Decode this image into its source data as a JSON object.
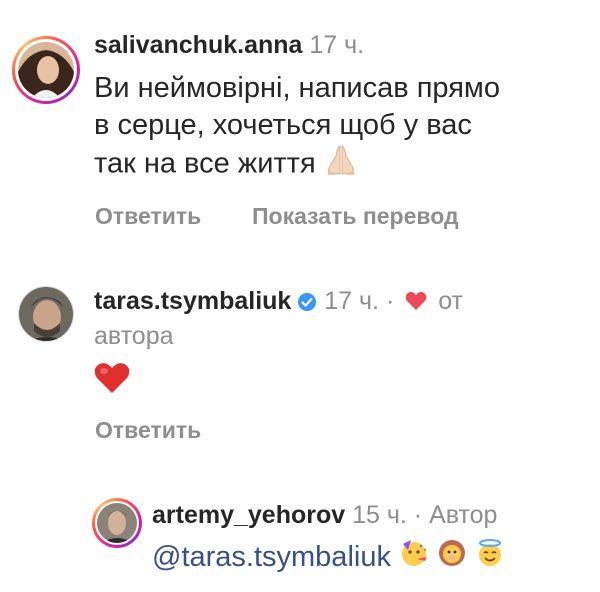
{
  "comments": [
    {
      "username": "salivanchuk.anna",
      "time": "17 ч.",
      "text_lines": [
        "Ви неймовірні, написав прямо",
        "в серце, хочеться щоб у вас",
        "так на все життя"
      ],
      "text_emoji": "praying-hands",
      "actions": [
        "Ответить",
        "Показать перевод"
      ]
    },
    {
      "username": "taras.tsymbaliuk",
      "verified": true,
      "time": "17 ч.",
      "separator": "·",
      "liked_by_author_prefix": "от",
      "liked_by_author_line2": "автора",
      "body_emoji": "red-heart",
      "actions": [
        "Ответить"
      ]
    },
    {
      "username": "artemy_yehorov",
      "time": "15 ч.",
      "separator": "·",
      "author_label": "Автор",
      "mention": "@taras.tsymbaliuk",
      "emojis": [
        "partying-face",
        "lion-face",
        "smiling-face-with-halo"
      ]
    }
  ],
  "colors": {
    "text": "#262626",
    "meta": "#8e8e8e",
    "mention": "#385185",
    "heart": "#ed4956",
    "verified": "#3897f0"
  }
}
